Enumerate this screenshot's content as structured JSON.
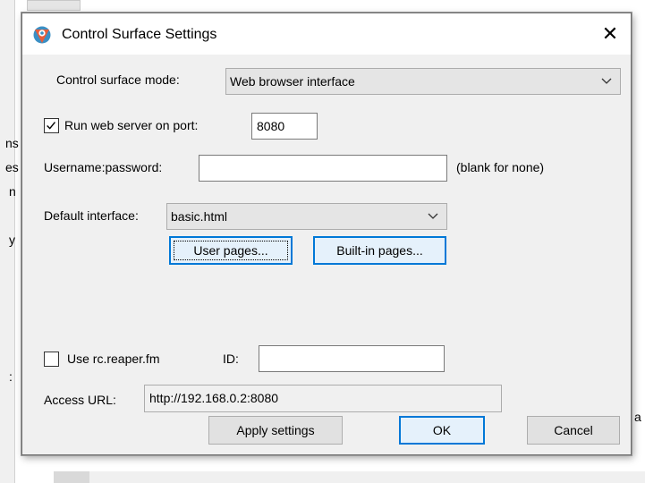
{
  "dialog": {
    "title": "Control Surface Settings",
    "close_glyph": "✕"
  },
  "mode": {
    "label": "Control surface mode:",
    "value": "Web browser interface"
  },
  "web_server": {
    "label": "Run web server on port:",
    "checked": true,
    "port": "8080"
  },
  "auth": {
    "label": "Username:password:",
    "value": "",
    "hint": "(blank for none)"
  },
  "default_interface": {
    "label": "Default interface:",
    "value": "basic.html"
  },
  "pages": {
    "user_pages": "User pages...",
    "builtin_pages": "Built-in pages..."
  },
  "rc": {
    "label": "Use rc.reaper.fm",
    "checked": false,
    "id_label": "ID:",
    "id_value": ""
  },
  "access": {
    "label": "Access URL:",
    "value": "http://192.168.0.2:8080"
  },
  "buttons": {
    "apply": "Apply settings",
    "ok": "OK",
    "cancel": "Cancel"
  },
  "background": {
    "left_fragments": [
      "ns",
      "es",
      "n",
      "y",
      ":"
    ],
    "right_fragment": "a"
  }
}
